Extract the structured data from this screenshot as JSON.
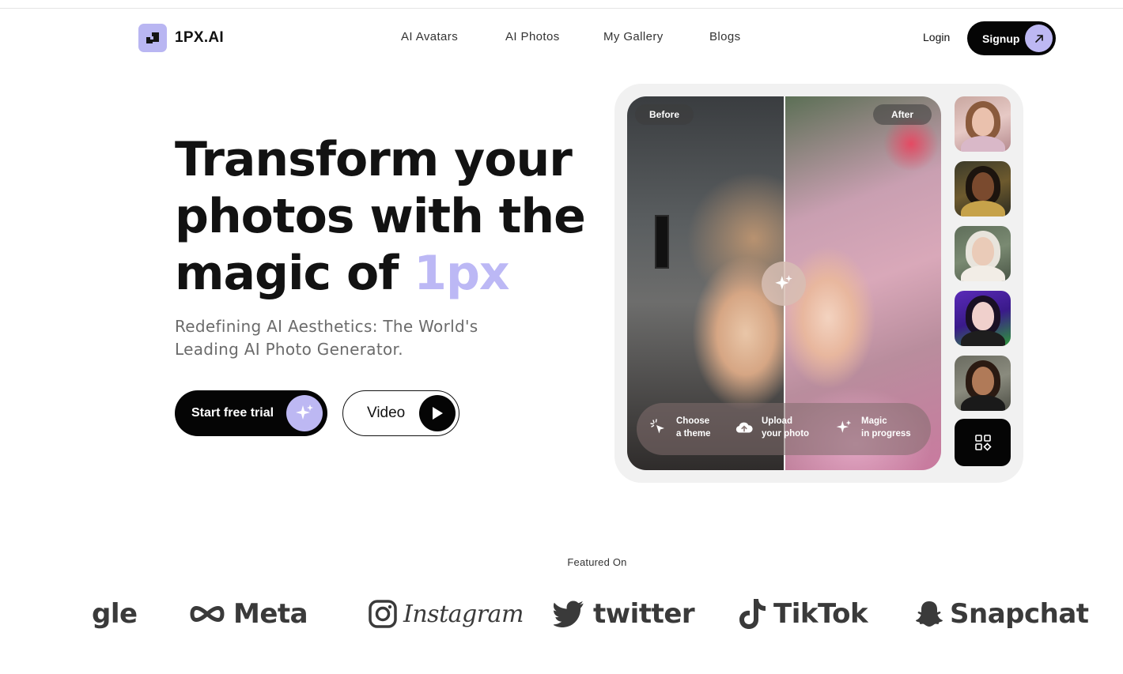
{
  "header": {
    "logo_text": "1PX.AI",
    "nav": [
      "AI Avatars",
      "AI Photos",
      "My Gallery",
      "Blogs"
    ],
    "login_label": "Login",
    "signup_label": "Signup"
  },
  "hero": {
    "headline_line1": "Transform your",
    "headline_line2": "photos with the",
    "headline_line3_prefix": "magic of ",
    "headline_accent": "1px",
    "subtitle": "Redefining AI Aesthetics: The World's Leading AI Photo Generator.",
    "primary_cta": "Start free trial",
    "secondary_cta": "Video"
  },
  "showcase": {
    "before_label": "Before",
    "after_label": "After",
    "steps": [
      {
        "line1": "Choose",
        "line2": "a theme",
        "icon": "cursor-click-icon"
      },
      {
        "line1": "Upload",
        "line2": "your photo",
        "icon": "cloud-upload-icon"
      },
      {
        "line1": "Magic",
        "line2": "in progress",
        "icon": "sparkle-icon"
      }
    ],
    "thumbnails": [
      "portrait-1",
      "portrait-2",
      "portrait-3",
      "portrait-4",
      "portrait-5"
    ],
    "more_icon": "grid-icon"
  },
  "featured": {
    "label": "Featured On",
    "brands": [
      "gle",
      "Meta",
      "Instagram",
      "twitter",
      "TikTok",
      "Snapchat"
    ]
  },
  "colors": {
    "accent": "#bcb8f5",
    "dark": "#050505",
    "muted_text": "#6b6b6b"
  }
}
